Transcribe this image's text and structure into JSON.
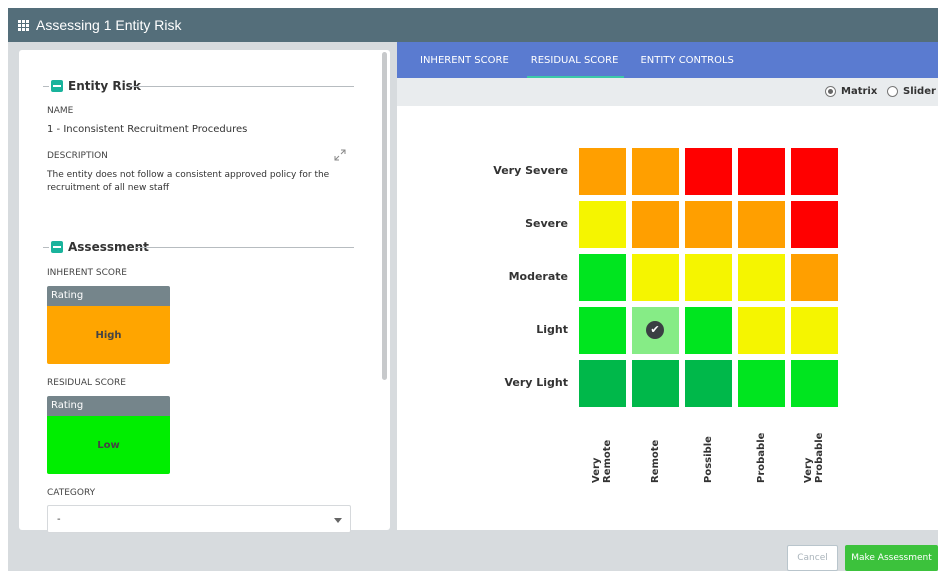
{
  "window": {
    "title": "Assessing 1 Entity Risk",
    "icon": "grid-icon"
  },
  "entity_risk": {
    "heading": "Entity Risk",
    "name_label": "NAME",
    "name_value": "1 - Inconsistent Recruitment Procedures",
    "description_label": "DESCRIPTION",
    "description_value": "The entity does not follow a consistent approved policy for the recruitment of all new staff"
  },
  "assessment": {
    "heading": "Assessment",
    "inherent_label": "INHERENT SCORE",
    "inherent_rating_header": "Rating",
    "inherent_rating_value": "High",
    "inherent_color": "#ffa500",
    "residual_label": "RESIDUAL SCORE",
    "residual_rating_header": "Rating",
    "residual_rating_value": "Low",
    "residual_color": "#00ee00",
    "category_label": "CATEGORY",
    "category_value": "-"
  },
  "tabs": [
    {
      "label": "INHERENT SCORE",
      "active": false
    },
    {
      "label": "RESIDUAL SCORE",
      "active": true
    },
    {
      "label": "ENTITY CONTROLS",
      "active": false
    }
  ],
  "view_toggle": {
    "matrix_label": "Matrix",
    "slider_label": "Slider",
    "selected": "Matrix"
  },
  "matrix": {
    "rows": [
      "Very Severe",
      "Severe",
      "Moderate",
      "Light",
      "Very Light"
    ],
    "columns": [
      "Very\nRemote",
      "Remote",
      "Possible",
      "Probable",
      "Very\nProbable"
    ],
    "colors": {
      "red": "#ff0000",
      "orange": "#ff9f00",
      "yellow": "#f5f500",
      "green": "#00e51f",
      "darkgreen": "#00b84a",
      "selected": "#86ec86"
    },
    "cells": [
      [
        "orange",
        "orange",
        "red",
        "red",
        "red"
      ],
      [
        "yellow",
        "orange",
        "orange",
        "orange",
        "red"
      ],
      [
        "green",
        "yellow",
        "yellow",
        "yellow",
        "orange"
      ],
      [
        "green",
        "selected",
        "green",
        "yellow",
        "yellow"
      ],
      [
        "darkgreen",
        "darkgreen",
        "darkgreen",
        "green",
        "green"
      ]
    ],
    "selected_row": 3,
    "selected_col": 1
  },
  "footer": {
    "cancel_label": "Cancel",
    "assess_label": "Make Assessment"
  }
}
